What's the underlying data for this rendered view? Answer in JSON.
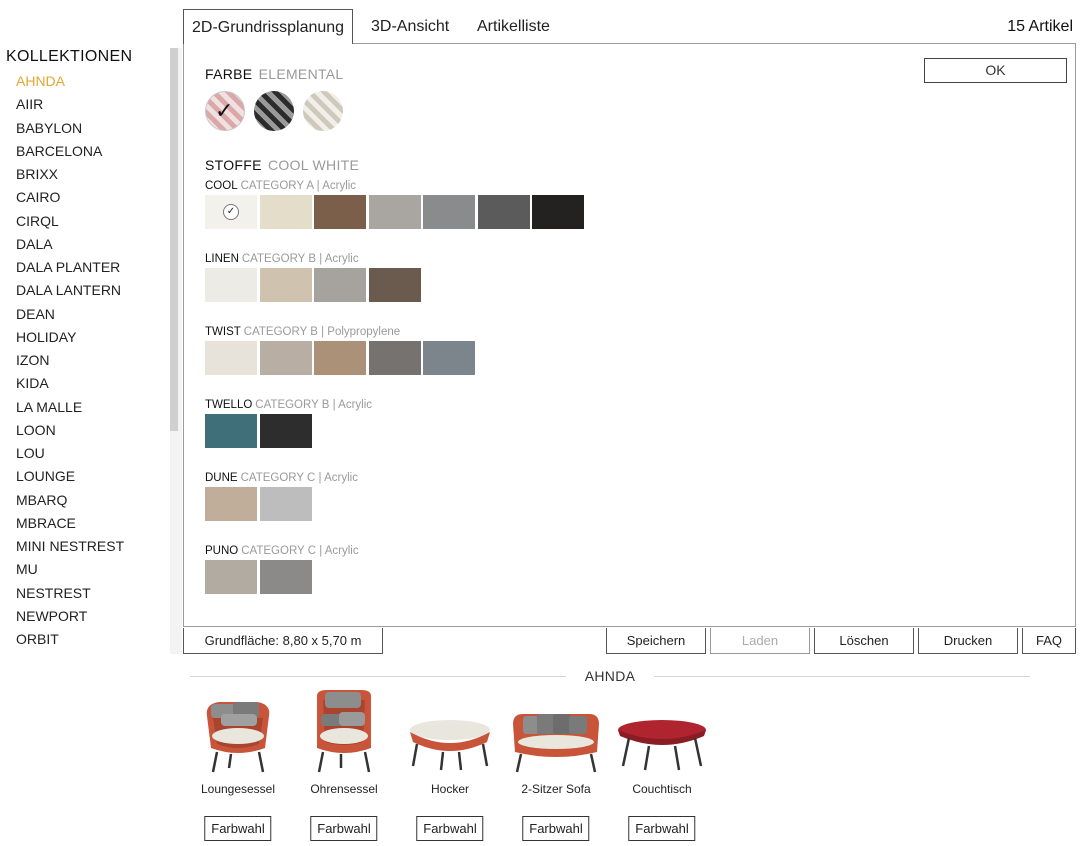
{
  "sidebar": {
    "title": "KOLLEKTIONEN",
    "items": [
      "AHNDA",
      "AIIR",
      "BABYLON",
      "BARCELONA",
      "BRIXX",
      "CAIRO",
      "CIRQL",
      "DALA",
      "DALA PLANTER",
      "DALA LANTERN",
      "DEAN",
      "HOLIDAY",
      "IZON",
      "KIDA",
      "LA MALLE",
      "LOON",
      "LOU",
      "LOUNGE",
      "MBARQ",
      "MBRACE",
      "MINI NESTREST",
      "MU",
      "NESTREST",
      "NEWPORT",
      "ORBIT"
    ],
    "active_item": "AHNDA"
  },
  "tabs": [
    {
      "label": "2D-Grundrissplanung",
      "active": true
    },
    {
      "label": "3D-Ansicht",
      "active": false
    },
    {
      "label": "Artikelliste",
      "active": false
    }
  ],
  "article_count": "15 Artikel",
  "panel": {
    "ok_label": "OK",
    "farbe": {
      "label": "FARBE",
      "value": "ELEMENTAL"
    },
    "stoffe": {
      "label": "STOFFE",
      "value": "COOL WHITE"
    },
    "color_swatches": [
      {
        "name": "elemental",
        "selected": true
      },
      {
        "name": "dark",
        "selected": false
      },
      {
        "name": "light",
        "selected": false
      }
    ],
    "fabrics": [
      {
        "name": "COOL",
        "category": "CATEGORY A | Acrylic",
        "colors": [
          "#f3f1ec",
          "#e4ddc9",
          "#7c5f4a",
          "#a9a6a2",
          "#8a8b8c",
          "#5b5b5c",
          "#242221"
        ]
      },
      {
        "name": "LINEN",
        "category": "CATEGORY B | Acrylic",
        "colors": [
          "#ecebe6",
          "#cfc3af",
          "#a6a29d",
          "#6b5a4e"
        ]
      },
      {
        "name": "TWIST",
        "category": "CATEGORY B | Polypropylene",
        "colors": [
          "#e8e3da",
          "#b8aea4",
          "#aa9177",
          "#767270",
          "#7c858b"
        ]
      },
      {
        "name": "TWELLO",
        "category": "CATEGORY B | Acrylic",
        "colors": [
          "#3f6f79",
          "#2d2d2e"
        ]
      },
      {
        "name": "DUNE",
        "category": "CATEGORY C | Acrylic",
        "colors": [
          "#c1ae9a",
          "#bdbdbd"
        ]
      },
      {
        "name": "PUNO",
        "category": "CATEGORY C | Acrylic",
        "colors": [
          "#b2aba1",
          "#8c8a88"
        ]
      }
    ]
  },
  "bottom_bar": {
    "grundflaeche": "Grundfläche: 8,80 x 5,70 m",
    "speichern": "Speichern",
    "laden": "Laden",
    "loeschen": "Löschen",
    "drucken": "Drucken",
    "faq": "FAQ"
  },
  "collection": {
    "name": "AHNDA",
    "products": [
      {
        "name": "Loungesessel",
        "button": "Farbwahl"
      },
      {
        "name": "Ohrensessel",
        "button": "Farbwahl"
      },
      {
        "name": "Hocker",
        "button": "Farbwahl"
      },
      {
        "name": "2-Sitzer Sofa",
        "button": "Farbwahl"
      },
      {
        "name": "Couchtisch",
        "button": "Farbwahl"
      }
    ]
  },
  "colors": {
    "accent": "#e3a72f",
    "rope": "#c8553a"
  }
}
